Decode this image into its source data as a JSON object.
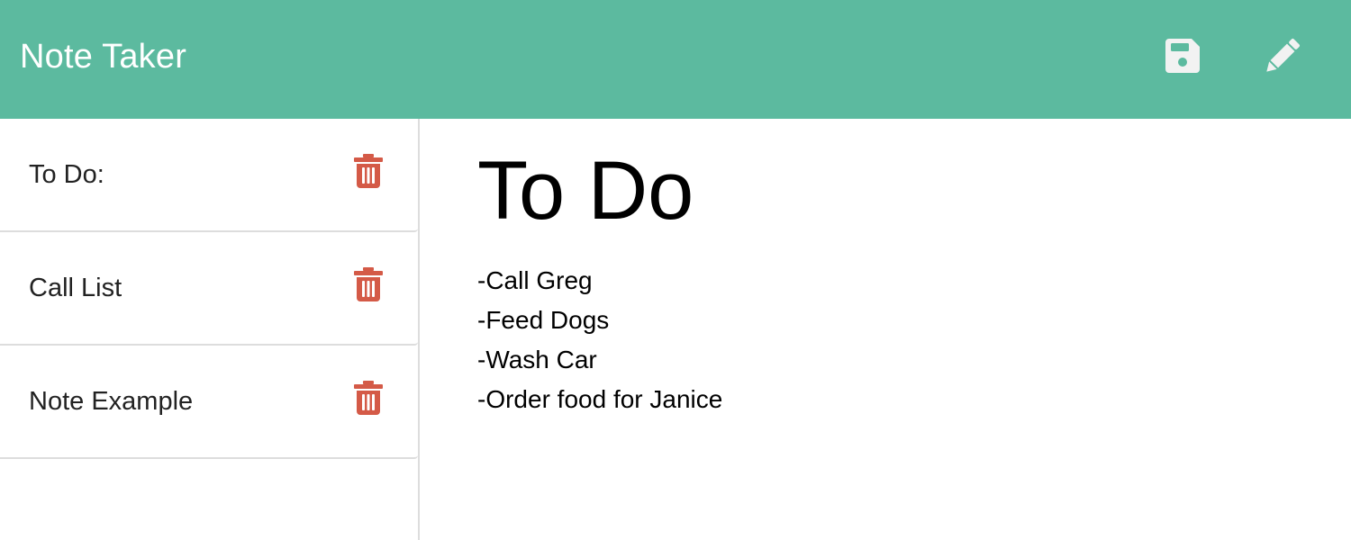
{
  "app": {
    "title": "Note Taker"
  },
  "navbar": {
    "save_icon": "save-icon",
    "write_icon": "pencil-icon",
    "icon_color": "#f2f2f2",
    "background": "#5cba9f"
  },
  "notes": [
    {
      "title": "To Do:"
    },
    {
      "title": "Call List"
    },
    {
      "title": "Note Example"
    }
  ],
  "delete_icon": "trash-icon",
  "delete_color": "#d45a47",
  "editor": {
    "title_value": "To Do",
    "body_value": "-Call Greg\n-Feed Dogs\n-Wash Car\n-Order food for Janice"
  }
}
